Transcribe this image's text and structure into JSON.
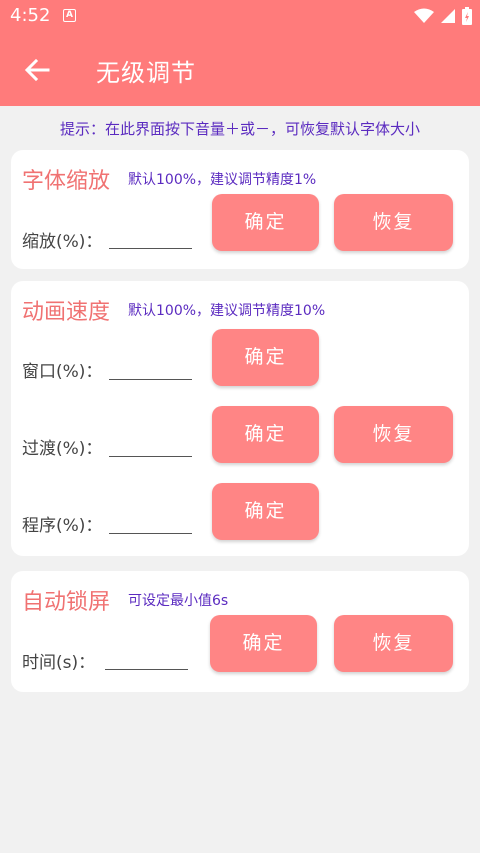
{
  "statusbar": {
    "time": "4:52",
    "notif_letter": "A"
  },
  "appbar": {
    "title": "无级调节"
  },
  "hint": "提示：在此界面按下音量＋或－，可恢复默认字体大小",
  "font_scale": {
    "title": "字体缩放",
    "note": "默认100%，建议调节精度1%",
    "row_label": "缩放(%)：",
    "confirm": "确定",
    "restore": "恢复"
  },
  "anim_speed": {
    "title": "动画速度",
    "note": "默认100%，建议调节精度10%",
    "rows": [
      {
        "label": "窗口(%)：",
        "confirm": "确定"
      },
      {
        "label": "过渡(%)：",
        "confirm": "确定",
        "restore": "恢复"
      },
      {
        "label": "程序(%)：",
        "confirm": "确定"
      }
    ]
  },
  "auto_lock": {
    "title": "自动锁屏",
    "note": "可设定最小值6s",
    "row_label": "时间(s)：",
    "confirm": "确定",
    "restore": "恢复"
  },
  "colors": {
    "primary": "#ff7b7b",
    "button": "#ff8585",
    "title": "#f07272",
    "note": "#5b2bc0"
  }
}
